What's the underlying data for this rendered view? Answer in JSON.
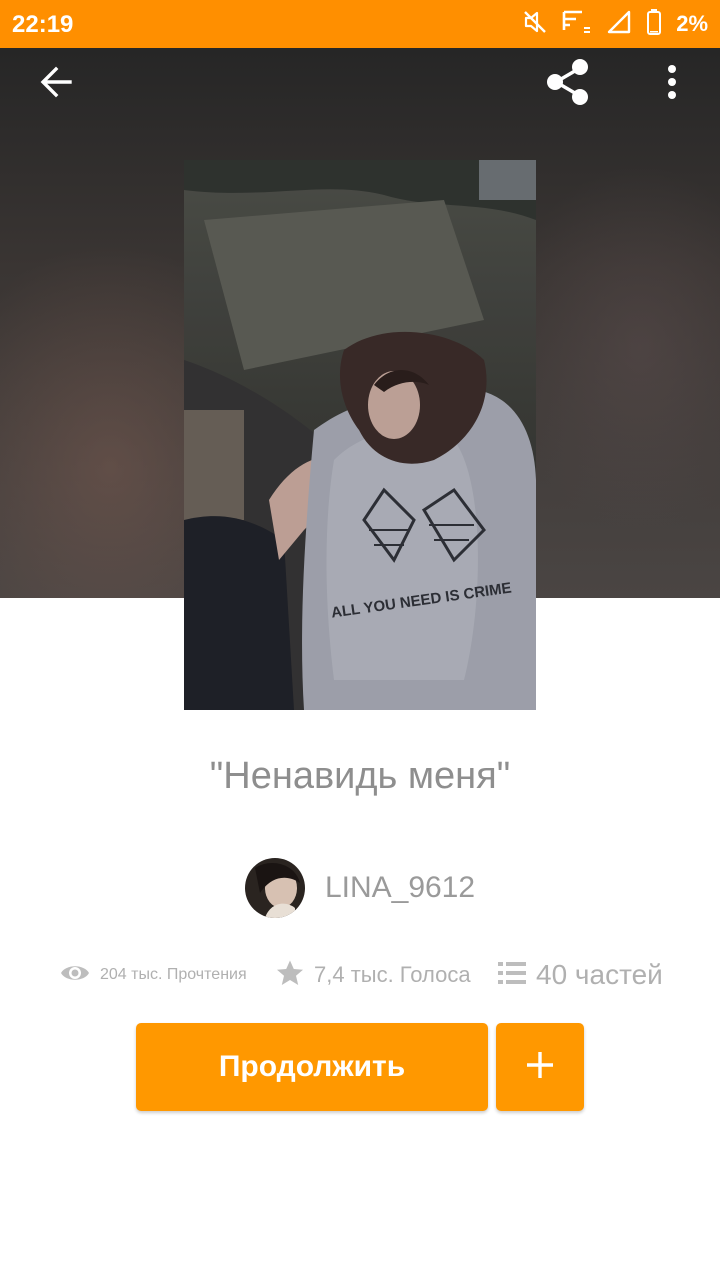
{
  "status_bar": {
    "time": "22:19",
    "battery_percent": "2%",
    "background_color": "#ff8f00",
    "icons": [
      "mute-icon",
      "signal-small-icon",
      "cellular-icon",
      "battery-icon"
    ]
  },
  "toolbar": {
    "icons": [
      "back-arrow-icon",
      "share-icon",
      "more-vert-icon"
    ]
  },
  "story": {
    "title": "\"Ненавидь меня\"",
    "author": "LINA_9612",
    "cover_text": "ALL YOU NEED IS CRIME"
  },
  "stats": {
    "reads": "204 тыс. Прочтения",
    "votes": "7,4 тыс. Голоса",
    "parts": "40 частей",
    "icons": [
      "eye-icon",
      "star-icon",
      "list-icon"
    ]
  },
  "actions": {
    "continue_label": "Продолжить",
    "add_icon": "plus-icon",
    "accent_color": "#ff9800"
  }
}
